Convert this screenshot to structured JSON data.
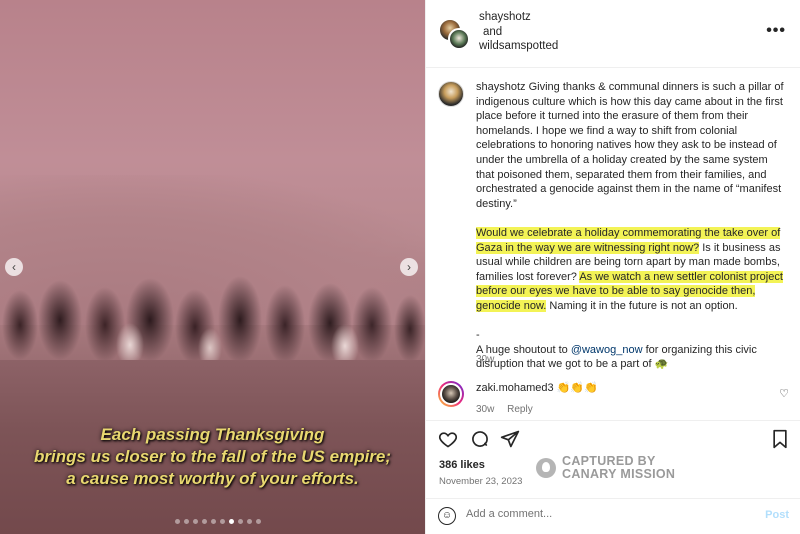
{
  "media": {
    "caption_line1": "Each passing Thanksgiving",
    "caption_line2": "brings us closer to the fall of the US empire;",
    "caption_line3": "a cause most worthy of your efforts.",
    "carousel_dots": 10,
    "active_dot": 6,
    "prev_arrow": "‹",
    "next_arrow": "›"
  },
  "header": {
    "user1": "shayshotz",
    "joiner": "and",
    "user2": "wildsamspotted",
    "more": "•••"
  },
  "caption": {
    "username": "shayshotz",
    "p1": "Giving thanks & communal dinners is such a pillar of indigenous culture which is how this day came about in the first place before it turned into the erasure of them from their homelands. I hope we find a way to shift from colonial celebrations to honoring natives how they ask to be instead of under the umbrella of a holiday created by the same system that poisoned them, separated them from their families, and orchestrated a genocide against them in the name of “manifest destiny.”",
    "p2_hl1": "Would we celebrate a holiday commemorating the take over of Gaza in the way we are witnessing right now?",
    "p2_plain1": " Is it business as usual while children are being torn apart by man made bombs, families lost forever? ",
    "p2_hl2": "As we watch a new settler colonist project before our eyes we have to be able to say genocide then, genocide now.",
    "p2_plain2": " Naming it in the future is not an option.",
    "dash": "-",
    "p3_pre": "A huge shoutout to ",
    "p3_mention": "@wawog_now",
    "p3_post": " for organizing this civic disruption that we got to be a part of 🐢",
    "time": "30w"
  },
  "reply": {
    "username": "zaki.mohamed3",
    "text": "👏👏👏",
    "time": "30w",
    "reply_label": "Reply",
    "heart": "♡"
  },
  "actions": {
    "likes": "386 likes",
    "date": "November 23, 2023"
  },
  "watermark": {
    "line1": "CAPTURED BY",
    "line2": "CANARY MISSION"
  },
  "add_comment": {
    "placeholder": "Add a comment...",
    "post_label": "Post",
    "emoji": "☺"
  }
}
